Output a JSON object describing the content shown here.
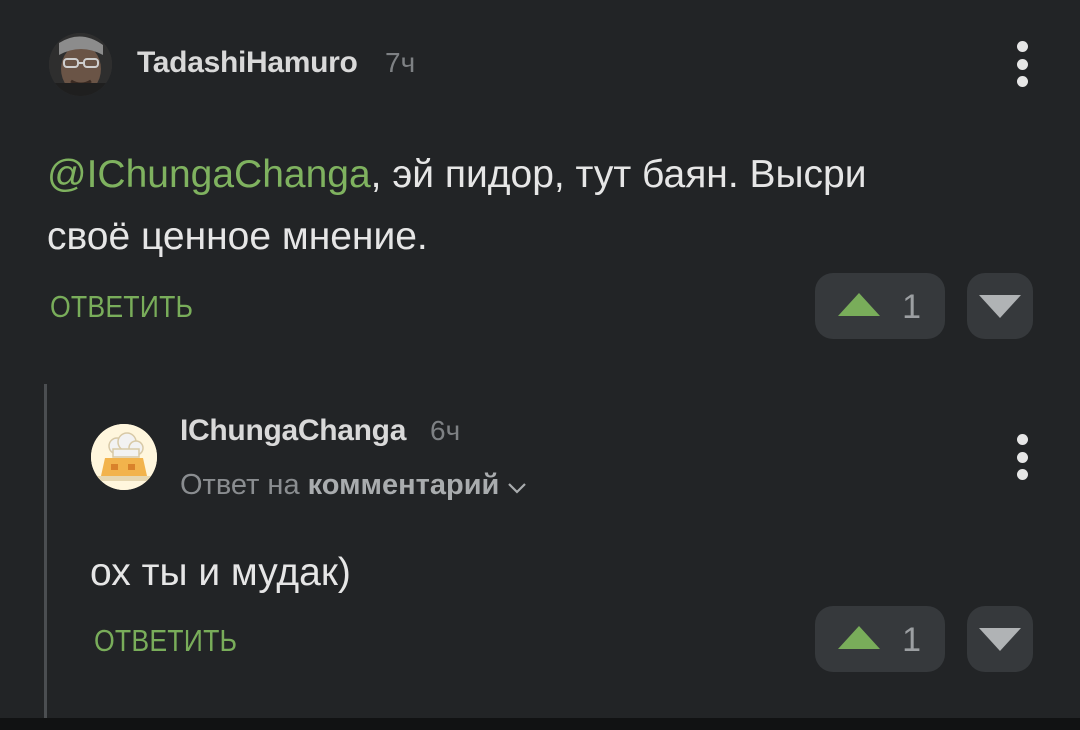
{
  "comments": [
    {
      "author": "TadashiHamuro",
      "time": "7ч",
      "mention": "@IChungaChanga",
      "text_line1_rest": ", эй пидор, тут баян. Высри",
      "text_line2": "своё ценное мнение.",
      "reply_label": "ОТВЕТИТЬ",
      "rating": "1",
      "avatar_icon": "user-photo-avatar",
      "menu_icon": "kebab-menu-icon"
    },
    {
      "author": "IChungaChanga",
      "time": "6ч",
      "reply_to_prefix": "Ответ на",
      "reply_to_link": "комментарий",
      "text": "ох ты и мудак)",
      "reply_label": "ОТВЕТИТЬ",
      "rating": "1",
      "avatar_icon": "chef-hat-avatar",
      "menu_icon": "kebab-menu-icon"
    }
  ],
  "colors": {
    "background": "#222426",
    "accent_green": "#79ad5a",
    "mention_green": "#7fb25f",
    "vote_button_bg": "#36393c",
    "text_primary": "#e6e6e6",
    "text_muted": "#7e8184"
  }
}
